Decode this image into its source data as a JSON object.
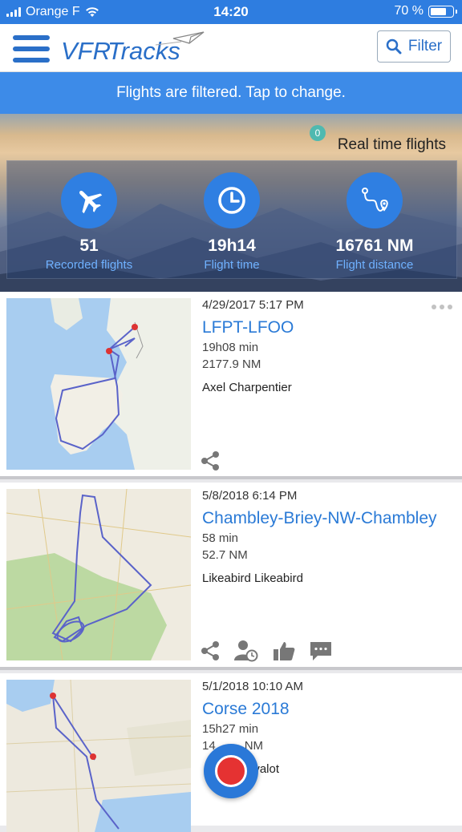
{
  "status_bar": {
    "carrier": "Orange F",
    "time": "14:20",
    "battery": "70 %"
  },
  "header": {
    "logo_text": "VFRTracks",
    "filter_label": "Filter"
  },
  "banner": {
    "text": "Flights are filtered. Tap to change."
  },
  "realtime": {
    "label": "Real time flights",
    "count": "0"
  },
  "stats": [
    {
      "value": "51",
      "label": "Recorded flights",
      "icon": "airplane-icon"
    },
    {
      "value": "19h14",
      "label": "Flight time",
      "icon": "clock-icon"
    },
    {
      "value": "16761 NM",
      "label": "Flight distance",
      "icon": "route-icon"
    }
  ],
  "flights": [
    {
      "date": "4/29/2017 5:17 PM",
      "title": "LFPT-LFOO",
      "duration": "19h08 min",
      "distance": "2177.9 NM",
      "pilot": "Axel Charpentier",
      "actions": [
        "share-icon"
      ]
    },
    {
      "date": "5/8/2018 6:14 PM",
      "title": "Chambley-Briey-NW-Chambley",
      "duration": "58 min",
      "distance": "52.7 NM",
      "pilot": "Likeabird Likeabird",
      "actions": [
        "share-icon",
        "follow-icon",
        "like-icon",
        "comment-icon"
      ]
    },
    {
      "date": "5/1/2018 10:10 AM",
      "title": "Corse 2018",
      "duration": "15h27 min",
      "distance": "14",
      "distance_tail": "NM",
      "pilot": "",
      "pilot_tail": "uvalot"
    }
  ],
  "colors": {
    "primary": "#2e7de0",
    "link": "#2a7ad6",
    "record": "#e53232"
  }
}
